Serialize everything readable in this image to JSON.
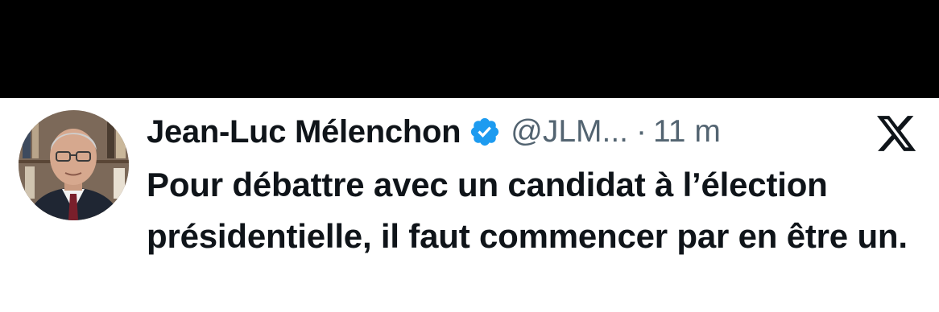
{
  "tweet": {
    "author_name": "Jean-Luc Mélenchon",
    "handle": "@JLM...",
    "separator": "·",
    "time": "11 m",
    "text": "Pour débattre avec un candidat à l’élection présidentielle, il faut commencer par en être un."
  },
  "icons": {
    "verified": "verified-badge-icon",
    "platform_logo": "x-logo-icon"
  },
  "colors": {
    "verified_badge": "#1d9bf0",
    "secondary_text": "#536471",
    "primary_text": "#0f1419",
    "top_band": "#000000"
  }
}
